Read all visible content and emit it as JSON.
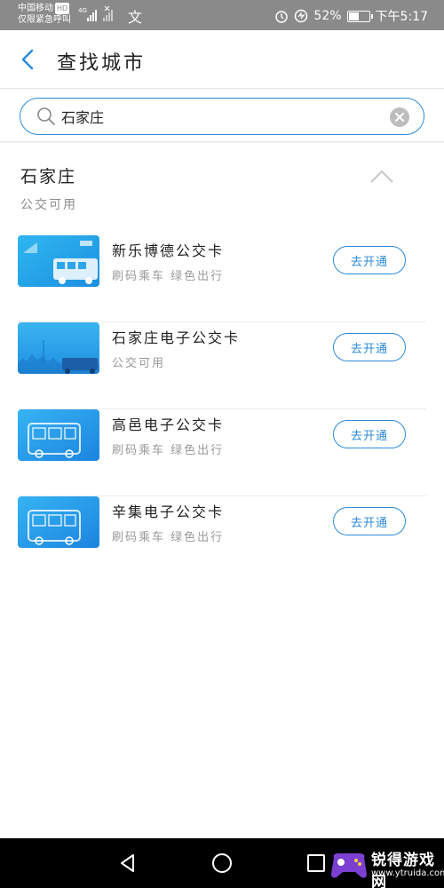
{
  "status_bar": {
    "carrier": "中国移动",
    "hd": "HD",
    "emergency": "仅限紧急呼叫",
    "network": "4G",
    "wen_icon": "文",
    "battery_percent": "52%",
    "battery_level": 0.52,
    "time": "下午5:17"
  },
  "header": {
    "title": "查找城市"
  },
  "search": {
    "value": "石家庄"
  },
  "city": {
    "name": "石家庄",
    "subtitle": "公交可用"
  },
  "cards": [
    {
      "name": "新乐博德公交卡",
      "desc": "刷码乘车  绿色出行",
      "button": "去开通"
    },
    {
      "name": "石家庄电子公交卡",
      "desc": "公交可用",
      "button": "去开通"
    },
    {
      "name": "高邑电子公交卡",
      "desc": "刷码乘车  绿色出行",
      "button": "去开通"
    },
    {
      "name": "辛集电子公交卡",
      "desc": "刷码乘车  绿色出行",
      "button": "去开通"
    }
  ],
  "watermark": {
    "text": "锐得游戏网",
    "url": "www.ytruida.com"
  },
  "colors": {
    "accent": "#2d8bd9",
    "card_blue": "#1e9bea"
  },
  "icons": [
    "back-icon",
    "search-icon",
    "clear-icon",
    "chevron-up-icon",
    "alarm-icon",
    "battery-icon",
    "nav-back-icon",
    "nav-home-icon",
    "nav-recents-icon"
  ]
}
